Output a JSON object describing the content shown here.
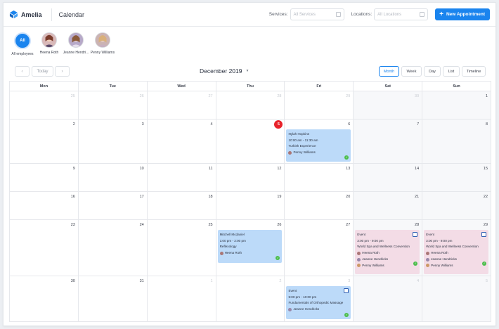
{
  "header": {
    "brand": "Amelia",
    "title": "Calendar",
    "services_label": "Services:",
    "services_placeholder": "All Services",
    "locations_label": "Locations:",
    "locations_placeholder": "All Locations",
    "new_button": "New Appointment"
  },
  "employees": [
    {
      "name": "All employees",
      "initials": "All"
    },
    {
      "name": "Heena Roth"
    },
    {
      "name": "Jeanne Hendri..."
    },
    {
      "name": "Penny Williams"
    }
  ],
  "toolbar": {
    "today": "Today",
    "month_title": "December 2019",
    "views": [
      "Month",
      "Week",
      "Day",
      "List",
      "Timeline"
    ],
    "active_view": "Month"
  },
  "calendar": {
    "weekdays": [
      "Mon",
      "Tue",
      "Wed",
      "Thu",
      "Fri",
      "Sat",
      "Sun"
    ],
    "weeks": [
      [
        "25",
        "26",
        "27",
        "28",
        "29",
        "30",
        "1"
      ],
      [
        "2",
        "3",
        "4",
        "5",
        "6",
        "7",
        "8"
      ],
      [
        "9",
        "10",
        "11",
        "12",
        "13",
        "14",
        "15"
      ],
      [
        "16",
        "17",
        "18",
        "19",
        "20",
        "21",
        "22"
      ],
      [
        "23",
        "24",
        "25",
        "26",
        "27",
        "28",
        "29"
      ],
      [
        "30",
        "31",
        "1",
        "2",
        "3",
        "4",
        "5"
      ]
    ],
    "today": "5"
  },
  "appointments": {
    "a1": {
      "name": "Nylah Hopkins",
      "time": "10:00 am - 11:30 am",
      "service": "Turkish Experience",
      "person": "Penny Williams"
    },
    "a2": {
      "name": "Mitchell Mcdaniel",
      "time": "1:00 pm - 2:00 pm",
      "service": "Reflexology",
      "person": "Heena Roth"
    },
    "a3": {
      "name": "Event",
      "time": "3:00 pm - 9:00 pm",
      "service": "World Spa and Wellness Convention",
      "people": [
        "Heena Roth",
        "Jeanne Hendricks",
        "Penny Williams"
      ]
    },
    "a4": {
      "name": "Event",
      "time": "3:00 pm - 9:00 pm",
      "service": "World Spa and Wellness Convention",
      "people": [
        "Heena Roth",
        "Jeanne Hendricks",
        "Penny Williams"
      ]
    },
    "a5": {
      "name": "Event",
      "time": "5:00 pm - 10:00 pm",
      "service": "Fundamentals of Orthopedic Massage",
      "person": "Jeanne Hendricks"
    }
  },
  "colors": {
    "accent": "#1a84ee",
    "today": "#e8232b",
    "appt_blue": "#bcdaf9",
    "event_pink": "#f3dce6",
    "approved": "#4cbe4c"
  }
}
